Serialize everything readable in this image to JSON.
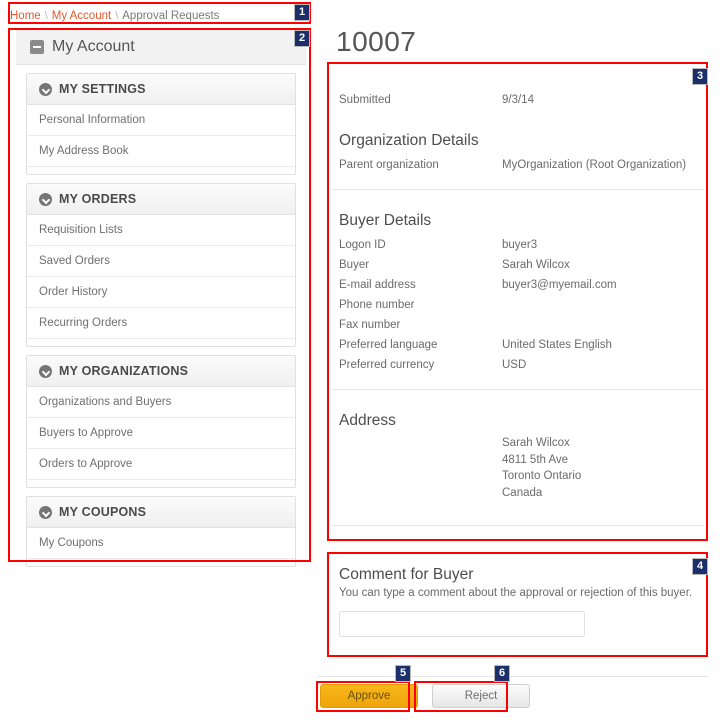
{
  "breadcrumb": {
    "separator": "\\",
    "items": [
      {
        "label": "Home",
        "current": false
      },
      {
        "label": "My Account",
        "current": false
      },
      {
        "label": "Approval Requests",
        "current": true
      }
    ]
  },
  "sidebar": {
    "title": "My Account",
    "collapse_icon": "minus-icon",
    "sections": [
      {
        "title": "MY SETTINGS",
        "icon": "chevron-down-icon",
        "links": [
          "Personal Information",
          "My Address Book"
        ]
      },
      {
        "title": "MY ORDERS",
        "icon": "chevron-down-icon",
        "links": [
          "Requisition Lists",
          "Saved Orders",
          "Order History",
          "Recurring Orders"
        ]
      },
      {
        "title": "MY ORGANIZATIONS",
        "icon": "chevron-down-icon",
        "links": [
          "Organizations and Buyers",
          "Buyers to Approve",
          "Orders to Approve"
        ]
      },
      {
        "title": "MY COUPONS",
        "icon": "chevron-down-icon",
        "links": [
          "My Coupons"
        ]
      }
    ]
  },
  "main": {
    "title": "10007",
    "submitted": {
      "label": "Submitted",
      "value": "9/3/14"
    },
    "organization_details": {
      "heading": "Organization Details",
      "rows": [
        {
          "label": "Parent organization",
          "value": "MyOrganization (Root Organization)"
        }
      ]
    },
    "buyer_details": {
      "heading": "Buyer Details",
      "rows": [
        {
          "label": "Logon ID",
          "value": "buyer3"
        },
        {
          "label": "Buyer",
          "value": "Sarah Wilcox"
        },
        {
          "label": "E-mail address",
          "value": "buyer3@myemail.com"
        },
        {
          "label": "Phone number",
          "value": ""
        },
        {
          "label": "Fax number",
          "value": ""
        },
        {
          "label": "Preferred language",
          "value": "United States English"
        },
        {
          "label": "Preferred currency",
          "value": "USD"
        }
      ]
    },
    "address": {
      "heading": "Address",
      "lines": [
        "Sarah Wilcox",
        "4811 5th Ave",
        "Toronto Ontario",
        "Canada"
      ]
    }
  },
  "comment": {
    "title": "Comment for Buyer",
    "description": "You can type a comment about the approval or rejection of this buyer.",
    "value": "",
    "placeholder": ""
  },
  "actions": {
    "approve_label": "Approve",
    "reject_label": "Reject"
  },
  "annotations": {
    "colors": {
      "box": "#ff0000",
      "badge_bg": "#1b2f6b",
      "badge_text": "#ffffff"
    },
    "badges": [
      "1",
      "2",
      "3",
      "4",
      "5",
      "6"
    ]
  },
  "colors": {
    "link": "#e8562b",
    "approve_button": "#efa40c",
    "text": "#6b6b6b"
  }
}
